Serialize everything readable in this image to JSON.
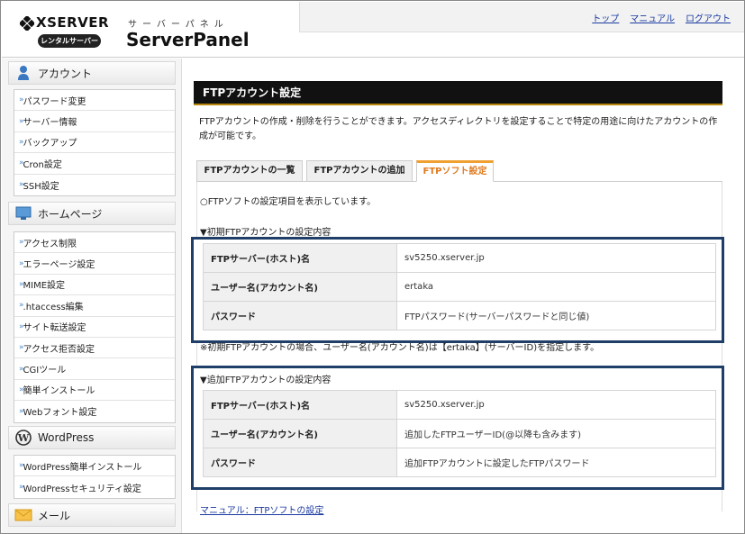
{
  "header": {
    "logo_xserver": "XSERVER",
    "logo_rental": "レンタルサーバー",
    "logo_kana": "サーバーパネル",
    "logo_panel": "ServerPanel",
    "links": [
      "トップ",
      "マニュアル",
      "ログアウト"
    ]
  },
  "sidebar": {
    "sections": [
      {
        "title": "アカウント",
        "icon": "person-icon",
        "items": [
          "パスワード変更",
          "サーバー情報",
          "バックアップ",
          "Cron設定",
          "SSH設定"
        ]
      },
      {
        "title": "ホームページ",
        "icon": "monitor-icon",
        "items": [
          "アクセス制限",
          "エラーページ設定",
          "MIME設定",
          ".htaccess編集",
          "サイト転送設定",
          "アクセス拒否設定",
          "CGIツール",
          "簡単インストール",
          "Webフォント設定"
        ]
      },
      {
        "title": "WordPress",
        "icon": "wordpress-icon",
        "items": [
          "WordPress簡単インストール",
          "WordPressセキュリティ設定"
        ]
      },
      {
        "title": "メール",
        "icon": "envelope-icon",
        "items": []
      }
    ]
  },
  "main": {
    "title": "FTPアカウント設定",
    "description": "FTPアカウントの作成・削除を行うことができます。アクセスディレクトリを設定することで特定の用途に向けたアカウントの作成が可能です。",
    "tabs": [
      {
        "label": "FTPアカウントの一覧",
        "active": false
      },
      {
        "label": "FTPアカウントの追加",
        "active": false
      },
      {
        "label": "FTPソフト設定",
        "active": true
      }
    ],
    "intro": "○FTPソフトの設定項目を表示しています。",
    "initial": {
      "heading": "▼初期FTPアカウントの設定内容",
      "rows": [
        {
          "key": "FTPサーバー(ホスト)名",
          "value": "sv5250.xserver.jp"
        },
        {
          "key": "ユーザー名(アカウント名)",
          "value": "ertaka"
        },
        {
          "key": "パスワード",
          "value": "FTPパスワード(サーバーパスワードと同じ値)"
        }
      ]
    },
    "note": "※初期FTPアカウントの場合、ユーザー名(アカウント名)は【ertaka】(サーバーID)を指定します。",
    "additional": {
      "heading": "▼追加FTPアカウントの設定内容",
      "rows": [
        {
          "key": "FTPサーバー(ホスト)名",
          "value": "sv5250.xserver.jp"
        },
        {
          "key": "ユーザー名(アカウント名)",
          "value": "追加したFTPユーザーID(@以降も含みます)"
        },
        {
          "key": "パスワード",
          "value": "追加FTPアカウントに設定したFTPパスワード"
        }
      ]
    },
    "manual_link": "マニュアル：FTPソフトの設定"
  },
  "colors": {
    "title_bar": "#111111",
    "highlight_box": "#1f3e68",
    "active_tab": "#e07a1f",
    "link": "#1a3aa0"
  }
}
